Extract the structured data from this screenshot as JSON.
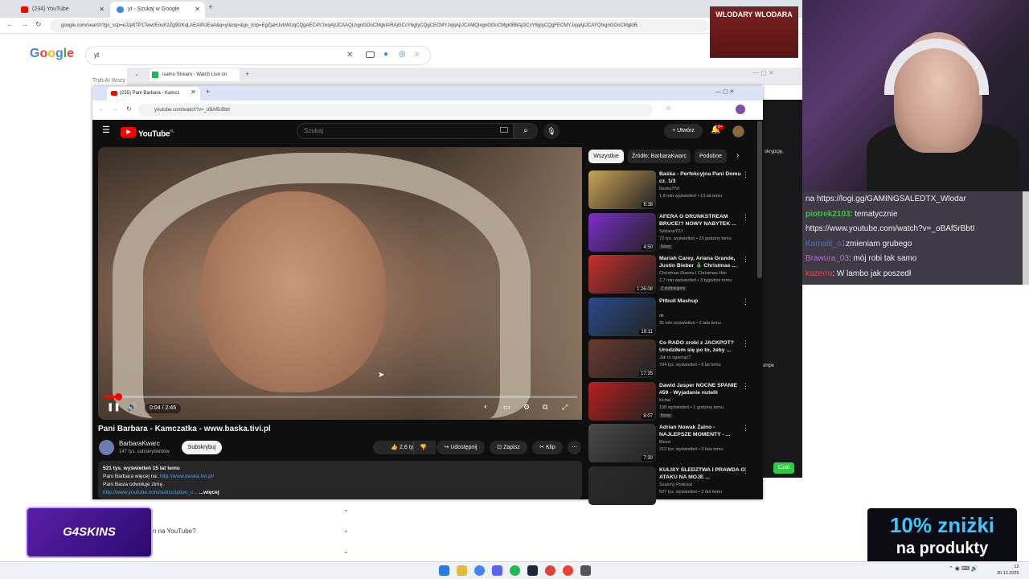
{
  "outer_browser": {
    "tabs": [
      "(234) YouTube",
      "yt - Szukaj w Google"
    ],
    "url": "google.com/search?gs_ssp=eJzj4tTP1TewzEouKzZg9GKqLAEAI0UEaA&q=yt&oq=&gs_lcrp=EgZjaHJvbWUqCQgAEC4YJxiqAjIJCAAQLhgnGOoCMgkIARAjGCcY6gIyCQgCECMYJxjqAjIJCAMQIxgnGOoCMgkIBBAjGCcY6gIyCQgFECMYJxjqAjIJCAYQIxgnGOoCMgkIB",
    "google_logo": "Google",
    "search_value": "yt",
    "tabs_row": "Tryb AI   Wszy"
  },
  "middle_window": {
    "tab_title": "isamu Stream - Watch Live on"
  },
  "yt_browser": {
    "tab_title": "(235) Pani Barbara - Kamcz",
    "url": "youtube.com/watch?v=_oBAf5rBbtI"
  },
  "yt": {
    "logo": "YouTube",
    "logo_sup": "PL",
    "search_placeholder": "Szukaj",
    "create_label": "+ Utwórz",
    "notif_count": "9+",
    "time": "0:04 / 2:45",
    "video_title": "Pani Barbara - Kamczatka - www.baska.tivi.pl",
    "channel_name": "BarbaraKwarc",
    "channel_subs": "147 tys. subskrybentów",
    "subscribe": "Subskrybuj",
    "likes": "2,6 tys.",
    "share": "Udostępnij",
    "save": "Zapisz",
    "clip": "Klip",
    "desc_line1": "521 tys. wyświetleń  15 lat temu",
    "desc_line2": "Pani Barbara więcej na: ",
    "desc_link1": "http://www.baska.tivi.pl/",
    "desc_line3": "Pani Basia odwołuje zimę.",
    "desc_link2": "http://www.youtube.com/subscription_c...",
    "desc_more": " ...więcej",
    "chips": [
      "Wszystkie",
      "Źródło: BarbaraKwarc",
      "Podobne"
    ]
  },
  "related": [
    {
      "title": "Baśka - Perfekcyjna Pani Domu cz. 1/3",
      "channel": "BaskaTIVI",
      "meta": "1,8 mln wyświetleń • 13 lat temu",
      "duration": "6:38",
      "badge": "",
      "color": "#c9a25a"
    },
    {
      "title": "AFERA O DRUNKSTREAM BRUCE!? NOWY NABYTEK ...",
      "channel": "SzklanaY2J",
      "meta": "72 tys. wyświetleń • 23 godziny temu",
      "duration": "4:50",
      "badge": "Nowy",
      "color": "#7a2ec8"
    },
    {
      "title": "Mariah Carey, Ariana Grande, Justin Bieber 🎄 Christmas ...",
      "channel": "Christmas Diaries I Christmas Hits",
      "meta": "2,7 mln wyświetleń • 3 tygodnie temu",
      "duration": "1:26:08",
      "badge": "Z dubbingiem",
      "color": "#c8302e"
    },
    {
      "title": "Pitbull Mashup",
      "channel": "dk",
      "meta": "35 mln wyświetleń • 2 lata temu",
      "duration": "19:11",
      "badge": "",
      "color": "#2a4a8a"
    },
    {
      "title": "Co RADO zrobi z JACKPOT? Urodziłem się po to, żeby ...",
      "channel": "Jak to ogarnąć?",
      "meta": "704 tys. wyświetleń • 6 lat temu",
      "duration": "17:35",
      "badge": "",
      "color": "#6a3a30"
    },
    {
      "title": "Dawid Jasper NOCNE SPANIE #59 - Wyjadanie nutelli",
      "channel": "kichal",
      "meta": "198 wyświetleń • 1 godzinę temu",
      "duration": "8:07",
      "badge": "Nowy",
      "color": "#b82020"
    },
    {
      "title": "Adrian Nowak Żalno - NAJLEPSZE MOMENTY - ...",
      "channel": "Messi",
      "meta": "212 tys. wyświetleń • 3 lata temu",
      "duration": "7:30",
      "badge": "",
      "color": "#4a4a4a"
    },
    {
      "title": "KULISY ŚLEDZTWA I PRAWDA O ATAKU NA MOJE ...",
      "channel": "Szalony Podcast",
      "meta": "507 tys. wyświetleń • 2 dni temu",
      "duration": "",
      "badge": "",
      "color": "#2a2a2a"
    }
  ],
  "chat": [
    {
      "user": "",
      "text": "na https://logi.gg/GAMINGSALEDTX_Wlodar",
      "ucls": ""
    },
    {
      "user": "piotrek2103",
      "text": ": tematycznie",
      "ucls": "u1"
    },
    {
      "user": "",
      "text": "https://www.youtube.com/watch?v=_oBAf5rBbtI",
      "ucls": ""
    },
    {
      "user": "Kamalit_o1",
      "text": "zmieniam grubego",
      "ucls": "u2"
    },
    {
      "user": "Brawura_03",
      "text": ": mój robi tak samo",
      "ucls": "u3"
    },
    {
      "user": "kazerro",
      "text": ": W lambo jak poszedł",
      "ucls": "u4"
    }
  ],
  "overlays": {
    "brand_logo": "WLODARY WLODARA",
    "sponsor": "G4SKINS",
    "promo_line1": "10% zniżki",
    "promo_line2": "na produkty",
    "chat_button": "Czat",
    "side_text1": "skrypcję,",
    "side_text2": "ampe"
  },
  "google_under": {
    "q1": "n na YouTube?"
  },
  "clock": {
    "time": "12",
    "date": "30.12.2025"
  }
}
